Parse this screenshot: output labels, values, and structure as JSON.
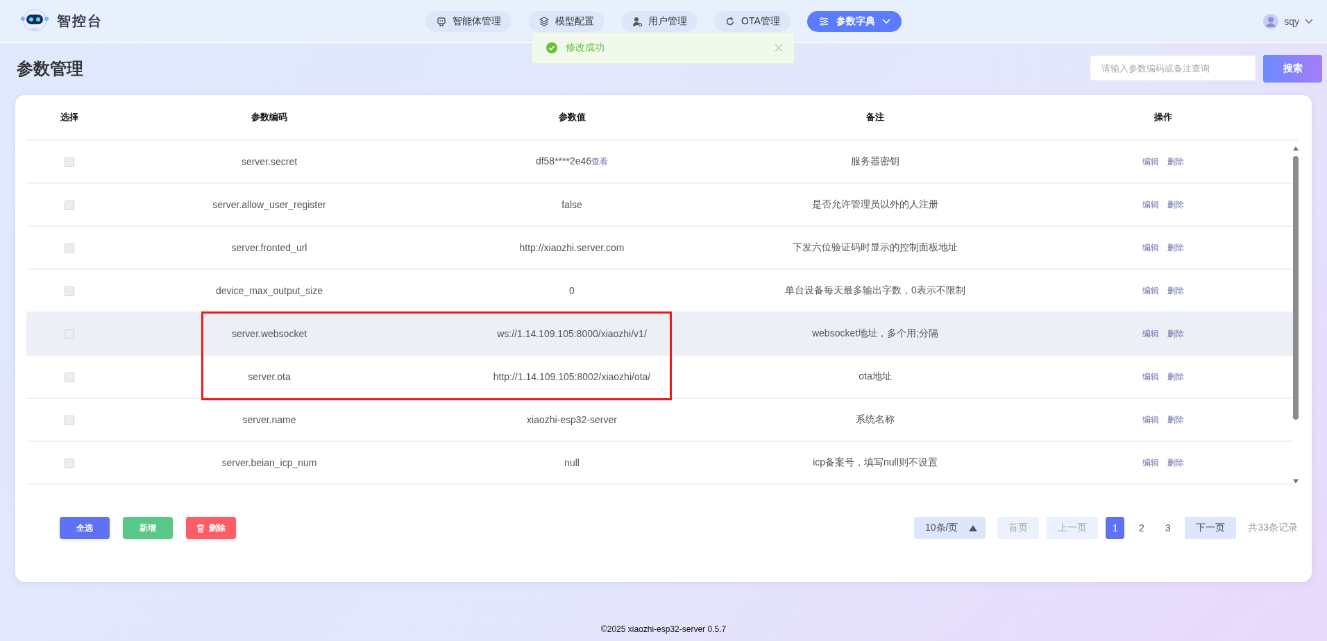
{
  "app": {
    "name": "智控台"
  },
  "nav": [
    {
      "label": "智能体管理",
      "selected": false,
      "dropdown": false
    },
    {
      "label": "模型配置",
      "selected": false,
      "dropdown": false
    },
    {
      "label": "用户管理",
      "selected": false,
      "dropdown": false
    },
    {
      "label": "OTA管理",
      "selected": false,
      "dropdown": false
    },
    {
      "label": "参数字典",
      "selected": true,
      "dropdown": true
    }
  ],
  "user": {
    "name": "sqy"
  },
  "toast": {
    "message": "修改成功"
  },
  "page_title": "参数管理",
  "search": {
    "placeholder": "请输入参数编码或备注查询",
    "button": "搜索"
  },
  "table": {
    "columns": [
      "选择",
      "参数编码",
      "参数值",
      "备注",
      "操作"
    ],
    "rows": [
      {
        "checked": false,
        "hovered": false,
        "highlighted": false,
        "code": "server.secret",
        "value": "df58****2e46",
        "value_link": "查看",
        "remark": "服务器密钥",
        "actions": [
          "编辑",
          "删除"
        ]
      },
      {
        "checked": false,
        "hovered": false,
        "highlighted": false,
        "code": "server.allow_user_register",
        "value": "false",
        "remark": "是否允许管理员以外的人注册",
        "actions": [
          "编辑",
          "删除"
        ]
      },
      {
        "checked": false,
        "hovered": false,
        "highlighted": false,
        "code": "server.fronted_url",
        "value": "http://xiaozhi.server.com",
        "remark": "下发六位验证码时显示的控制面板地址",
        "actions": [
          "编辑",
          "删除"
        ]
      },
      {
        "checked": false,
        "hovered": false,
        "highlighted": false,
        "code": "device_max_output_size",
        "value": "0",
        "remark": "单台设备每天最多输出字数，0表示不限制",
        "actions": [
          "编辑",
          "删除"
        ]
      },
      {
        "checked": false,
        "hovered": true,
        "highlighted": true,
        "code": "server.websocket",
        "value": "ws://1.14.109.105:8000/xiaozhi/v1/",
        "remark": "websocket地址，多个用;分隔",
        "actions": [
          "编辑",
          "删除"
        ]
      },
      {
        "checked": false,
        "hovered": false,
        "highlighted": true,
        "code": "server.ota",
        "value": "http://1.14.109.105:8002/xiaozhi/ota/",
        "remark": "ota地址",
        "actions": [
          "编辑",
          "删除"
        ]
      },
      {
        "checked": false,
        "hovered": false,
        "highlighted": false,
        "code": "server.name",
        "value": "xiaozhi-esp32-server",
        "remark": "系统名称",
        "actions": [
          "编辑",
          "删除"
        ]
      },
      {
        "checked": false,
        "hovered": false,
        "highlighted": false,
        "code": "server.beian_icp_num",
        "value": "null",
        "remark": "icp备案号，填写null则不设置",
        "actions": [
          "编辑",
          "删除"
        ]
      }
    ]
  },
  "bulk_buttons": [
    {
      "kind": "select",
      "label": "全选"
    },
    {
      "kind": "add",
      "label": "新增"
    },
    {
      "kind": "delete",
      "label": "删除"
    }
  ],
  "pagination": {
    "page_size": "10条/页",
    "first": {
      "label": "首页",
      "disabled": true
    },
    "prev": {
      "label": "上一页",
      "disabled": true
    },
    "pages": [
      {
        "label": "1",
        "selected": true
      },
      {
        "label": "2",
        "selected": false
      },
      {
        "label": "3",
        "selected": false
      }
    ],
    "next": {
      "label": "下一页",
      "disabled": false
    },
    "total": "共33条记录"
  },
  "footer": "©2025 xiaozhi-esp32-server 0.5.7"
}
